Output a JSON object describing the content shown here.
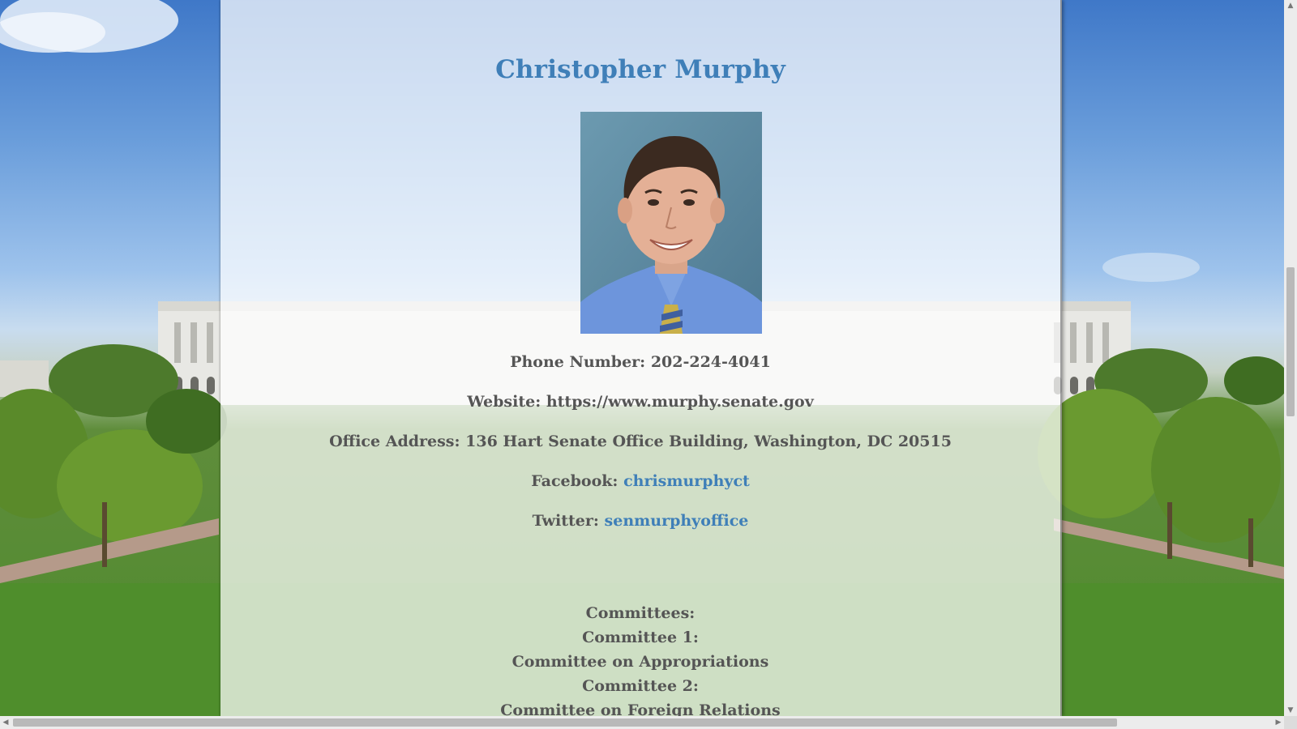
{
  "senator": {
    "name": "Christopher Murphy",
    "photo_alt": "Christopher Murphy portrait"
  },
  "contact": {
    "phone_label": "Phone Number:",
    "phone_value": "202-224-4041",
    "website_label": "Website:",
    "website_value": "https://www.murphy.senate.gov",
    "address_label": "Office Address:",
    "address_value": "136 Hart Senate Office Building, Washington, DC 20515",
    "facebook_label": "Facebook:",
    "facebook_value": "chrismurphyct",
    "twitter_label": "Twitter:",
    "twitter_value": "senmurphyoffice"
  },
  "committees": {
    "heading": "Committees:",
    "items": [
      {
        "label": "Committee 1:",
        "name": "Committee on Appropriations"
      },
      {
        "label": "Committee 2:",
        "name": "Committee on Foreign Relations"
      }
    ]
  },
  "colors": {
    "name_color": "#3f7fb8",
    "link_color": "#3f7fb8",
    "text_color": "#555555"
  },
  "icons": {
    "scroll_up": "▲",
    "scroll_down": "▼",
    "scroll_left": "◀",
    "scroll_right": "▶"
  }
}
